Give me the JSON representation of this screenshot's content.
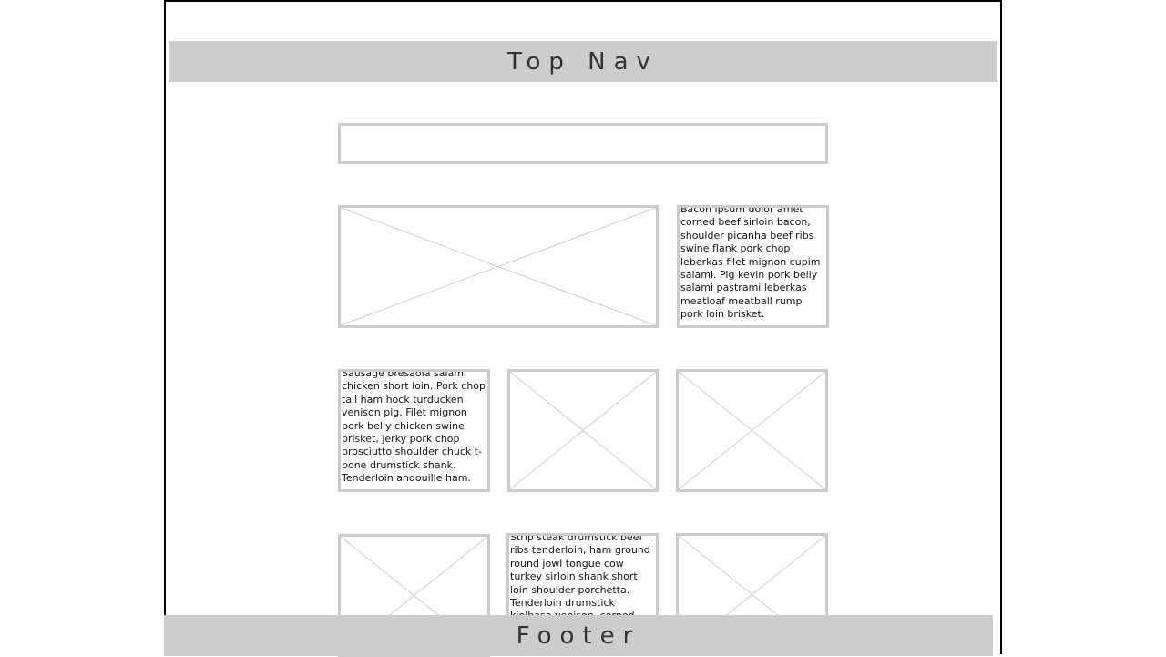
{
  "top_nav": {
    "label": "Top Nav"
  },
  "footer": {
    "label": "Footer"
  },
  "search_bar": {
    "value": ""
  },
  "text_blocks": [
    "Bacon ipsum dolor amet corned beef sirloin bacon, shoulder picanha beef ribs swine flank pork chop leberkas filet mignon cupim salami. Pig kevin pork belly salami pastrami leberkas meatloaf meatball rump pork loin brisket.",
    "Sausage bresaola salami chicken short loin. Pork chop tail ham hock turducken venison pig. Filet mignon pork belly chicken swine brisket, jerky pork chop prosciutto shoulder chuck t-bone drumstick shank. Tenderloin andouille ham.",
    "Strip steak drumstick beef ribs tenderloin, ham ground round jowl tongue cow turkey sirloin shank short loin shoulder porchetta. Tenderloin drumstick kielbasa venison, corned beef."
  ],
  "colors": {
    "placeholder_gray": "#cccccc",
    "frame_border": "#000000"
  },
  "icons": {
    "image_placeholder": "image-placeholder-icon"
  }
}
